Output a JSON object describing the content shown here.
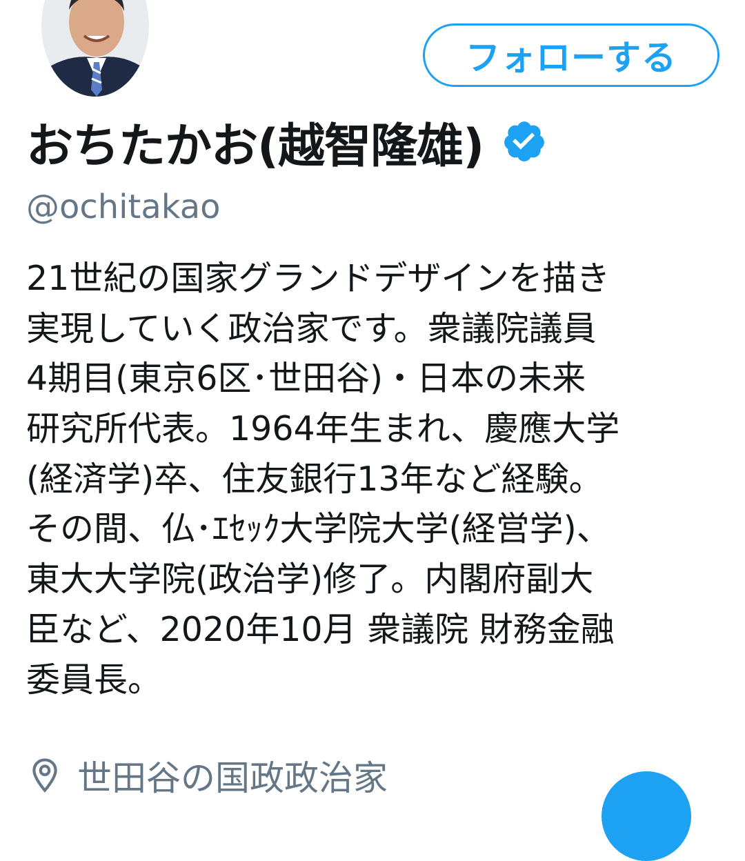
{
  "header": {
    "follow_label": "フォローする"
  },
  "profile": {
    "display_name": "おちたかお(越智隆雄)",
    "verified": true,
    "handle": "@ochitakao",
    "bio_lines": [
      "21世紀の国家グランドデザインを描き",
      "実現していく政治家です。衆議院議員",
      "4期目(東京6区･世田谷)・日本の未来",
      "研究所代表。1964年生まれ、慶應大学",
      "(経済学)卒、住友銀行13年など経験。",
      "その間、仏･ｴｾｯｸ大学院大学(経営学)、",
      "東大大学院(政治学)修了。内閣府副大",
      "臣など、2020年10月 衆議院 財務金融",
      "委員長。"
    ],
    "location": "世田谷の国政政治家"
  },
  "icons": {
    "verified": "verified-badge-icon",
    "location": "map-pin-icon",
    "fab": "compose-icon"
  },
  "colors": {
    "accent": "#1da1f2",
    "text_primary": "#14171a",
    "text_secondary": "#657786"
  }
}
